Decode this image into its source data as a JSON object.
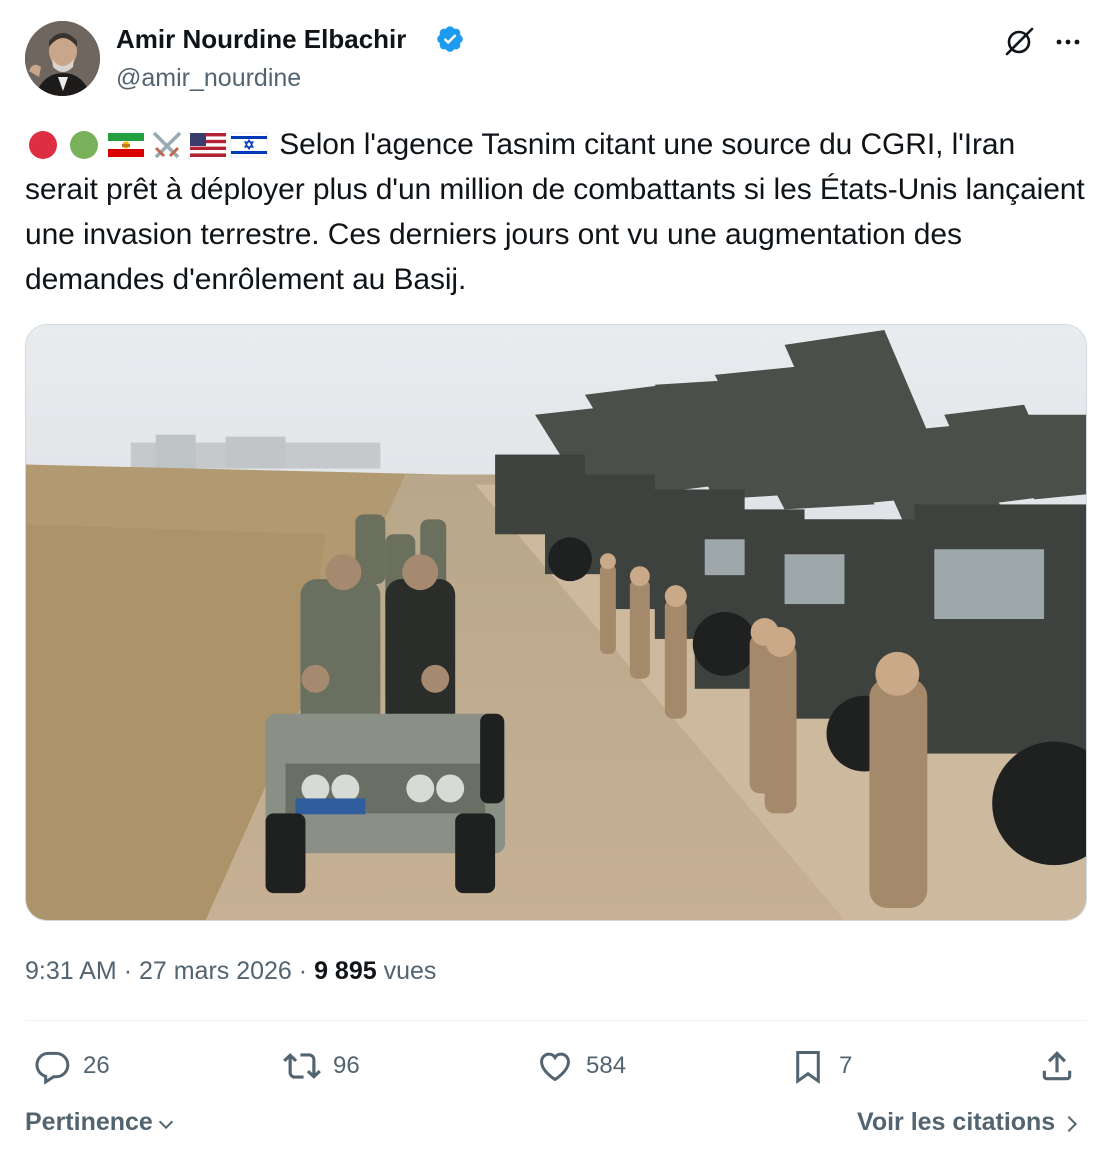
{
  "author": {
    "display_name": "Amir Nourdine Elbachir",
    "handle": "@amir_nourdine",
    "verified": true
  },
  "tweet": {
    "emojis": [
      "red-circle",
      "green-circle",
      "iran-lion-sun-flag",
      "crossed-swords",
      "us-flag",
      "israel-flag"
    ],
    "text_line1": "Selon l'agence Tasnim citant une source du CGRI,",
    "text_rest": "l'Iran serait prêt à déployer plus d'un million de combattants si les États-Unis lançaient une invasion terrestre. Ces derniers jours ont vu une augmentation des demandes d'enrôlement au Basij."
  },
  "meta": {
    "time": "9:31 AM",
    "date": "27 mars 2026",
    "views_count": "9 895",
    "views_label": "vues"
  },
  "actions": {
    "replies": "26",
    "reposts": "96",
    "likes": "584",
    "bookmarks": "7"
  },
  "footer": {
    "sort_label": "Pertinence",
    "quotes_label": "Voir les citations"
  },
  "colors": {
    "text_primary": "#0f1419",
    "text_secondary": "#536471",
    "verified_blue": "#1d9bf0",
    "divider": "#eff3f4"
  }
}
